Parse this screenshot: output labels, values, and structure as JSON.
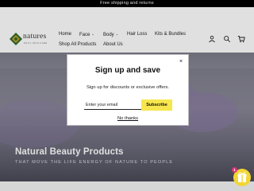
{
  "announcement": "Free shipping and returns",
  "brand": {
    "name": "natures",
    "tagline": "DAILY SKIN CARE"
  },
  "nav": [
    {
      "label": "Home",
      "dropdown": false
    },
    {
      "label": "Face",
      "dropdown": true
    },
    {
      "label": "Body",
      "dropdown": true
    },
    {
      "label": "Hair Loss",
      "dropdown": false
    },
    {
      "label": "Kits & Bundles",
      "dropdown": false
    },
    {
      "label": "Shop All Products",
      "dropdown": false
    },
    {
      "label": "About Us",
      "dropdown": false
    }
  ],
  "header_icons": [
    "user-icon",
    "search-icon",
    "cart-icon"
  ],
  "hero": {
    "title": "Natural Beauty Products",
    "subtitle": "THAT MOVE THE LIFE ENERGY OF NATURE TO PEOPLE"
  },
  "popup": {
    "close_symbol": "×",
    "title": "Sign up and save",
    "subtitle": "Sign up for discounts or exclusive offers.",
    "email_placeholder": "Enter your email",
    "subscribe_label": "Subscribe",
    "dismiss_label": "No thanks"
  },
  "gift_widget": {
    "badge_count": "1"
  },
  "colors": {
    "announcement_bg": "#000000",
    "subscribe_bg": "#f7e64e",
    "gift_bg": "#f2d633",
    "badge_bg": "#d9347b",
    "brand_green": "#2f6b2f",
    "brand_gold": "#c9a227"
  }
}
